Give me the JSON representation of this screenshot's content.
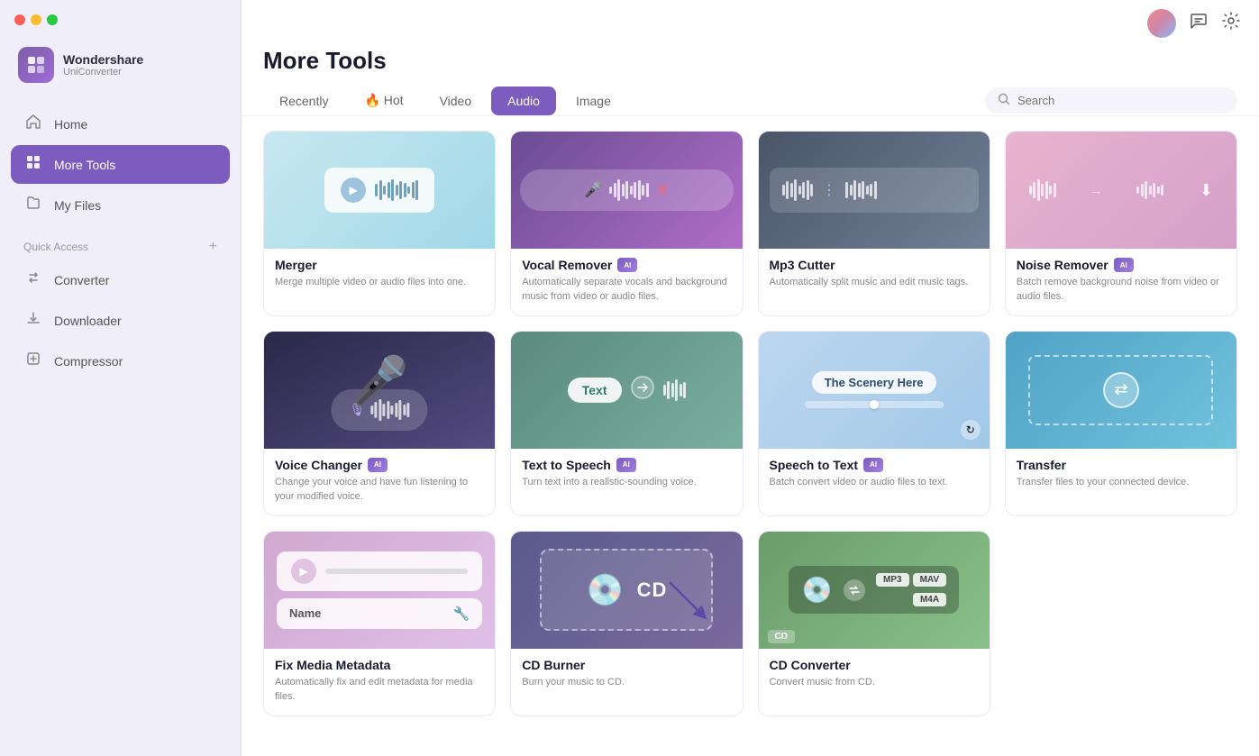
{
  "app": {
    "name": "Wondershare",
    "subtitle": "UniConverter"
  },
  "sidebar": {
    "nav_items": [
      {
        "id": "home",
        "label": "Home",
        "icon": "⌂",
        "active": false
      },
      {
        "id": "more-tools",
        "label": "More Tools",
        "icon": "⊞",
        "active": true
      },
      {
        "id": "my-files",
        "label": "My Files",
        "icon": "🗂",
        "active": false
      }
    ],
    "quick_access_label": "Quick Access",
    "quick_access_items": [
      {
        "id": "converter",
        "label": "Converter",
        "icon": "⇄"
      },
      {
        "id": "downloader",
        "label": "Downloader",
        "icon": "↓"
      },
      {
        "id": "compressor",
        "label": "Compressor",
        "icon": "◫"
      }
    ]
  },
  "page": {
    "title": "More Tools"
  },
  "tabs": [
    {
      "id": "recently",
      "label": "Recently",
      "active": false
    },
    {
      "id": "hot",
      "label": "🔥 Hot",
      "active": false
    },
    {
      "id": "video",
      "label": "Video",
      "active": false
    },
    {
      "id": "audio",
      "label": "Audio",
      "active": true
    },
    {
      "id": "image",
      "label": "Image",
      "active": false
    }
  ],
  "search": {
    "placeholder": "Search"
  },
  "tools": [
    {
      "id": "merger",
      "name": "Merger",
      "desc": "Merge multiple video or audio files into one.",
      "ai": false,
      "thumb_class": "thumb-merger"
    },
    {
      "id": "vocal-remover",
      "name": "Vocal Remover",
      "desc": "Automatically separate vocals and background music from video or audio files.",
      "ai": true,
      "thumb_class": "thumb-vocal"
    },
    {
      "id": "mp3-cutter",
      "name": "Mp3 Cutter",
      "desc": "Automatically split music and edit music tags.",
      "ai": false,
      "thumb_class": "thumb-mp3"
    },
    {
      "id": "noise-remover",
      "name": "Noise Remover",
      "desc": "Batch remove background noise from video or audio files.",
      "ai": true,
      "thumb_class": "thumb-noise"
    },
    {
      "id": "voice-changer",
      "name": "Voice Changer",
      "desc": "Change your voice and have fun listening to your modified voice.",
      "ai": true,
      "thumb_class": "thumb-voice"
    },
    {
      "id": "text-to-speech",
      "name": "Text to Speech",
      "desc": "Turn text into a realistic-sounding voice.",
      "ai": true,
      "thumb_class": "thumb-tts"
    },
    {
      "id": "speech-to-text",
      "name": "Speech to Text",
      "desc": "Batch convert video or audio files to text.",
      "ai": true,
      "thumb_class": "thumb-stt",
      "scenery": "The Scenery Here"
    },
    {
      "id": "transfer",
      "name": "Transfer",
      "desc": "Transfer files to your connected device.",
      "ai": false,
      "thumb_class": "thumb-transfer"
    },
    {
      "id": "fix-media-metadata",
      "name": "Fix Media Metadata",
      "desc": "Automatically fix and edit metadata for media files.",
      "ai": false,
      "thumb_class": "thumb-fixmeta"
    },
    {
      "id": "cd-burner",
      "name": "CD Burner",
      "desc": "Burn your music to CD.",
      "ai": false,
      "thumb_class": "thumb-cdburner"
    },
    {
      "id": "cd-converter",
      "name": "CD Converter",
      "desc": "Convert music from CD.",
      "ai": false,
      "thumb_class": "thumb-cdconverter"
    }
  ]
}
